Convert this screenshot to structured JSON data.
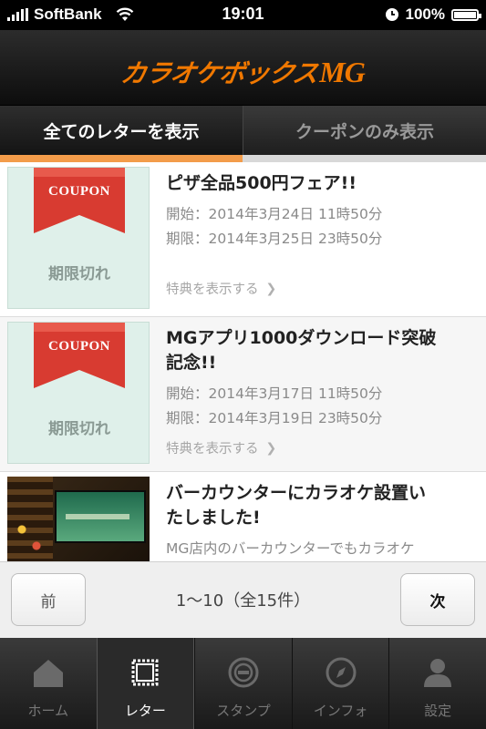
{
  "status_bar": {
    "carrier": "SoftBank",
    "time": "19:01",
    "battery": "100%",
    "battery_level": 1.0
  },
  "header": {
    "logo_text": "カラオケボックス",
    "logo_brand": "MG",
    "brand_color": "#f07800"
  },
  "tabs": [
    {
      "label": "全てのレターを表示",
      "active": true
    },
    {
      "label": "クーポンのみ表示",
      "active": false
    }
  ],
  "accent_color": "#f39c4a",
  "letters": [
    {
      "type": "coupon",
      "badge": "COUPON",
      "status": "期限切れ",
      "title": "ピザ全品500円フェア!!",
      "start": "開始：2014年3月24日 11時50分",
      "end": "期限：2014年3月25日 23時50分",
      "more": "特典を表示する"
    },
    {
      "type": "coupon",
      "badge": "COUPON",
      "status": "期限切れ",
      "title_line1": "MGアプリ1000ダウンロード突破",
      "title_line2": "記念!!",
      "start": "開始：2014年3月17日 11時50分",
      "end": "期限：2014年3月19日 23時50分",
      "more": "特典を表示する"
    },
    {
      "type": "news",
      "title_line1": "バーカウンターにカラオケ設置い",
      "title_line2": "たしました!",
      "summary": "MG店内のバーカウンターでもカラオケ"
    }
  ],
  "pager": {
    "prev": "前",
    "info": "1〜10（全15件）",
    "next": "次"
  },
  "tabbar": [
    {
      "label": "ホーム",
      "icon": "home-icon",
      "active": false
    },
    {
      "label": "レター",
      "icon": "stamp-frame-icon",
      "active": true
    },
    {
      "label": "スタンプ",
      "icon": "stamp-icon",
      "active": false
    },
    {
      "label": "インフォ",
      "icon": "compass-icon",
      "active": false
    },
    {
      "label": "設定",
      "icon": "person-icon",
      "active": false
    }
  ]
}
